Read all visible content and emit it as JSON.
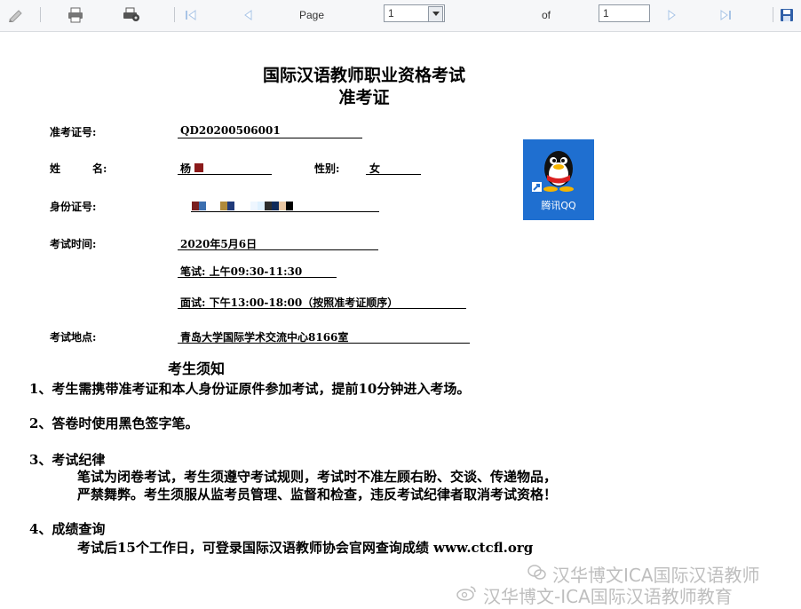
{
  "toolbar": {
    "page_label": "Page",
    "page_value": "1",
    "of_label": "of",
    "total_value": "1",
    "icons": [
      "pencil-icon",
      "print-icon",
      "printer-settings-icon",
      "first-page-icon",
      "prev-page-icon",
      "next-page-icon",
      "last-page-icon",
      "save-icon"
    ]
  },
  "doc": {
    "title1": "国际汉语教师职业资格考试",
    "title2": "准考证",
    "fields": {
      "ticket_label": "准考证号:",
      "ticket_value": "QD20200506001",
      "name_label": "姓　　　名:",
      "name_value": "杨",
      "gender_label": "性别:",
      "gender_value": "女",
      "id_label": "身份证号:",
      "time_label": "考试时间:",
      "date_value": "2020年5月6日",
      "written_value": "笔试:  上午09:30-11:30",
      "interview_value": "面试:  下午13:00-18:00（按照准考证顺序）",
      "place_label": "考试地点:",
      "place_value": "青岛大学国际学术交流中心8166室"
    },
    "qq_label": "腾讯QQ",
    "notice_title": "考生须知",
    "notices": [
      {
        "heading": "1、考生需携带准考证和本人身份证原件参加考试，提前10分钟进入考场。"
      },
      {
        "heading": "2、答卷时使用黑色签字笔。"
      },
      {
        "heading": "3、考试纪律",
        "lines": [
          "笔试为闭卷考试，考生须遵守考试规则，考试时不准左顾右盼、交谈、传递物品，",
          "严禁舞弊。考生须服从监考员管理、监督和检查，违反考试纪律者取消考试资格！"
        ]
      },
      {
        "heading": "4、成绩查询",
        "lines": [
          "考试后15个工作日，可登录国际汉语教师协会官网查询成绩   www.ctcfl.org"
        ]
      }
    ]
  },
  "watermark": {
    "line1": "汉华博文ICA国际汉语教师",
    "line2": "汉华博文-ICA国际汉语教师教育"
  },
  "colors": {
    "toolbar_bg": "#f6f7f9",
    "qq_bg": "#1f6fd0",
    "redact_red": "#8b1a1a"
  }
}
